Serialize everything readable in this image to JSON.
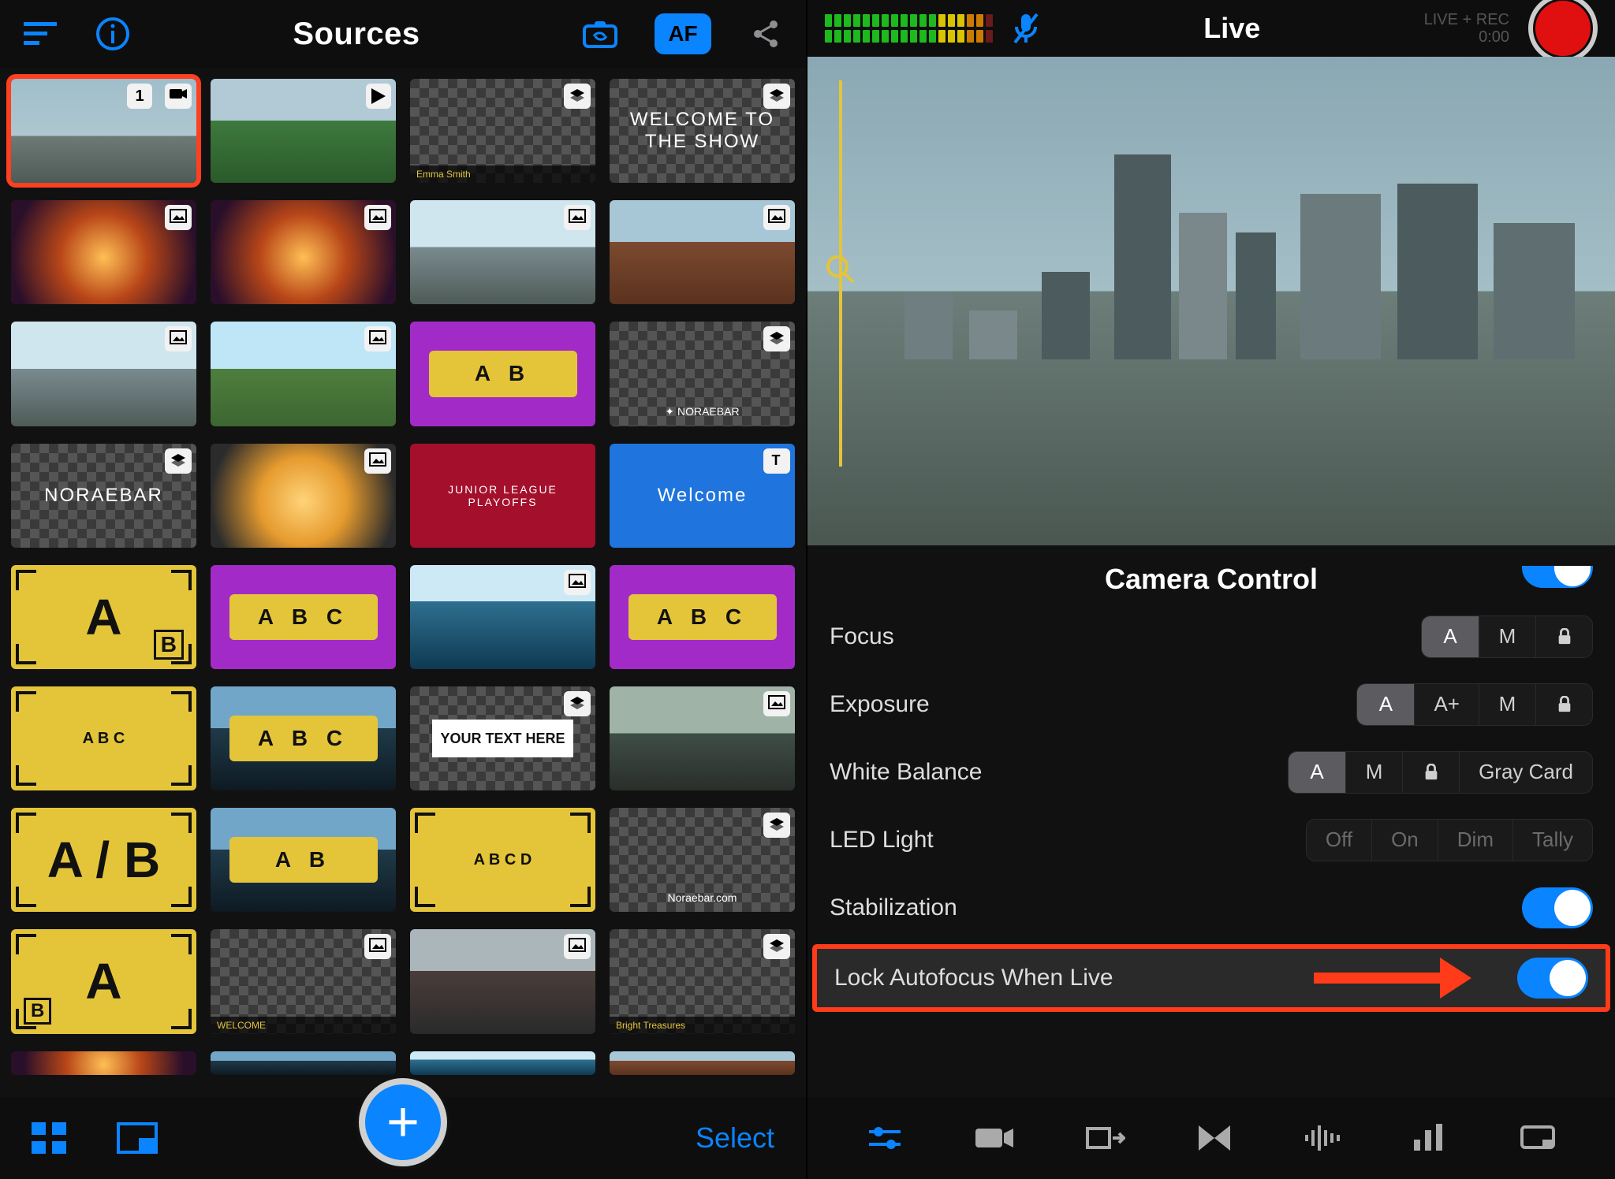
{
  "left": {
    "title": "Sources",
    "af_label": "AF",
    "footer": {
      "select_label": "Select"
    },
    "grid": [
      [
        {
          "kind": "camera-selected",
          "badge_num": "1",
          "icons": [
            "camera-icon"
          ]
        },
        {
          "kind": "video",
          "icons": [
            "play-icon"
          ],
          "style": "photo-stadium"
        },
        {
          "kind": "overlay",
          "icons": [
            "layers-icon"
          ],
          "style": "checker",
          "caption": "Emma Smith"
        },
        {
          "kind": "overlay",
          "icons": [
            "layers-icon"
          ],
          "style": "checker",
          "text": "WELCOME TO THE SHOW"
        }
      ],
      [
        {
          "kind": "image",
          "icons": [
            "image-icon"
          ],
          "style": "photo-stage"
        },
        {
          "kind": "image",
          "icons": [
            "image-icon"
          ],
          "style": "photo-stage"
        },
        {
          "kind": "image",
          "icons": [
            "image-icon"
          ],
          "style": "photo-city2"
        },
        {
          "kind": "image",
          "icons": [
            "image-icon"
          ],
          "style": "photo-brick"
        }
      ],
      [
        {
          "kind": "image",
          "icons": [
            "image-icon"
          ],
          "style": "photo-city2"
        },
        {
          "kind": "image",
          "icons": [
            "image-icon"
          ],
          "style": "photo-park"
        },
        {
          "kind": "yellow-AB",
          "text": "A  B",
          "style": "purple",
          "card": "yellow"
        },
        {
          "kind": "overlay",
          "icons": [
            "layers-icon"
          ],
          "style": "checker",
          "sublabel": "✦ NORAEBAR"
        }
      ],
      [
        {
          "kind": "overlay",
          "icons": [
            "layers-icon"
          ],
          "style": "checker",
          "text": "NORAEBAR",
          "textStyle": "pink"
        },
        {
          "kind": "image",
          "icons": [
            "image-icon"
          ],
          "style": "photo-food"
        },
        {
          "kind": "title-card",
          "style": "red-solid",
          "text": "JUNIOR LEAGUE PLAYOFFS"
        },
        {
          "kind": "text-card",
          "icons": [
            "text-icon"
          ],
          "style": "blue-solid",
          "text": "Welcome"
        }
      ],
      [
        {
          "kind": "yellow-Ab",
          "text": "A",
          "sub": "B",
          "style": "yellow-card huge"
        },
        {
          "kind": "yellow-ABC",
          "text": "A B C",
          "style": "purple",
          "card": "yellow"
        },
        {
          "kind": "image",
          "icons": [
            "image-icon"
          ],
          "style": "photo-lake"
        },
        {
          "kind": "yellow-ABC",
          "text": "A B C",
          "style": "purple",
          "card": "yellow"
        }
      ],
      [
        {
          "kind": "yellow-ABC",
          "text": "A B C",
          "style": "yellow-card"
        },
        {
          "kind": "yellow-ABC-over",
          "text": "A B C",
          "style": "photo-city3",
          "card": "yellow"
        },
        {
          "kind": "text-card",
          "icons": [
            "layers-icon"
          ],
          "style": "checker",
          "text": "YOUR TEXT HERE"
        },
        {
          "kind": "image",
          "icons": [
            "image-icon"
          ],
          "style": "photo-highway"
        }
      ],
      [
        {
          "kind": "yellow-AslashB",
          "text": "A / B",
          "style": "yellow-card huge"
        },
        {
          "kind": "yellow-AB-over",
          "text": "A  B",
          "style": "photo-city3",
          "card": "yellow"
        },
        {
          "kind": "yellow-ABCD",
          "text": "A B C D",
          "style": "yellow-card"
        },
        {
          "kind": "overlay",
          "icons": [
            "layers-icon"
          ],
          "style": "checker",
          "sublabel": "Noraebar.com"
        }
      ],
      [
        {
          "kind": "yellow-bA",
          "text": "A",
          "pre": "B",
          "style": "yellow-card huge"
        },
        {
          "kind": "overlay",
          "icons": [
            "image-icon"
          ],
          "style": "checker",
          "caption": "WELCOME"
        },
        {
          "kind": "image",
          "icons": [
            "image-icon"
          ],
          "style": "photo-people"
        },
        {
          "kind": "overlay",
          "icons": [
            "layers-icon"
          ],
          "style": "checker",
          "caption": "Bright Treasures"
        }
      ]
    ]
  },
  "right": {
    "title": "Live",
    "rec_chip_line1": "LIVE + REC",
    "rec_chip_line2": "0:00",
    "panel_title": "Camera Control",
    "audio_levels": {
      "greens": 12,
      "yellows": 3,
      "oranges": 2,
      "reds": 1
    },
    "controls": {
      "focus": {
        "label": "Focus",
        "options": [
          "A",
          "M",
          "lock"
        ],
        "selected": "A"
      },
      "exposure": {
        "label": "Exposure",
        "options": [
          "A",
          "A+",
          "M",
          "lock"
        ],
        "selected": "A"
      },
      "white_balance": {
        "label": "White Balance",
        "options": [
          "A",
          "M",
          "lock",
          "Gray Card"
        ],
        "selected": "A"
      },
      "led_light": {
        "label": "LED Light",
        "options": [
          "Off",
          "On",
          "Dim",
          "Tally"
        ],
        "selected": null
      },
      "stabilization": {
        "label": "Stabilization",
        "value": true
      },
      "lock_af_live": {
        "label": "Lock Autofocus When Live",
        "value": true
      }
    }
  }
}
